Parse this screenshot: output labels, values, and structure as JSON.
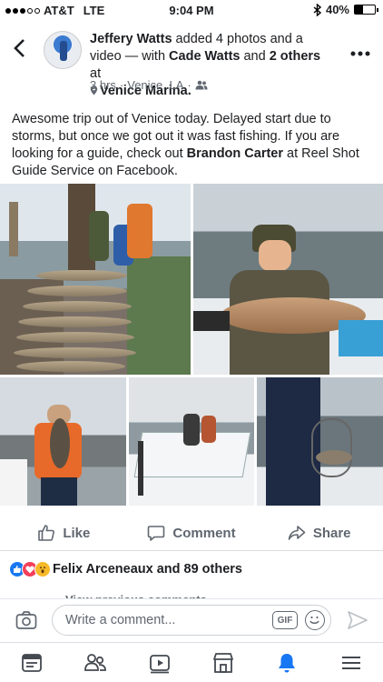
{
  "status_bar": {
    "carrier": "AT&T",
    "network": "LTE",
    "time": "9:04 PM",
    "battery": "40%",
    "battery_level": 0.4,
    "signal_bars": 3
  },
  "post": {
    "author": "Jeffery Watts",
    "action_text": " added 4 photos and a video — with ",
    "tagged_person": "Cade Watts",
    "and_text": " and ",
    "others_link": "2 others",
    "at_text": " at ",
    "location": "Venice Marina.",
    "time_ago": "3 hrs",
    "meta_sep": " · ",
    "place": "Venice, LA",
    "audience_sep": " ·",
    "body_part1": "Awesome trip out of Venice today. Delayed start due to storms, but once we got out it was fast fishing. If you are looking for a guide, check out ",
    "body_link": "Brandon Carter",
    "body_part2": " at Reel Shot Guide Service on Facebook."
  },
  "actions": {
    "like": "Like",
    "comment": "Comment",
    "share": "Share"
  },
  "reactions": {
    "summary": "Felix Arceneaux and 89 others",
    "icons": [
      "like-reaction",
      "love-reaction",
      "wow-reaction"
    ]
  },
  "comments": {
    "view_previous": "View previous comments"
  },
  "composer": {
    "placeholder": "Write a comment...",
    "gif_label": "GIF"
  },
  "tabs": [
    "news-feed",
    "friends",
    "watch",
    "marketplace",
    "notifications",
    "menu"
  ],
  "colors": {
    "accent": "#1877f2",
    "text_secondary": "#606770",
    "notification_tab": "#1877f2"
  }
}
